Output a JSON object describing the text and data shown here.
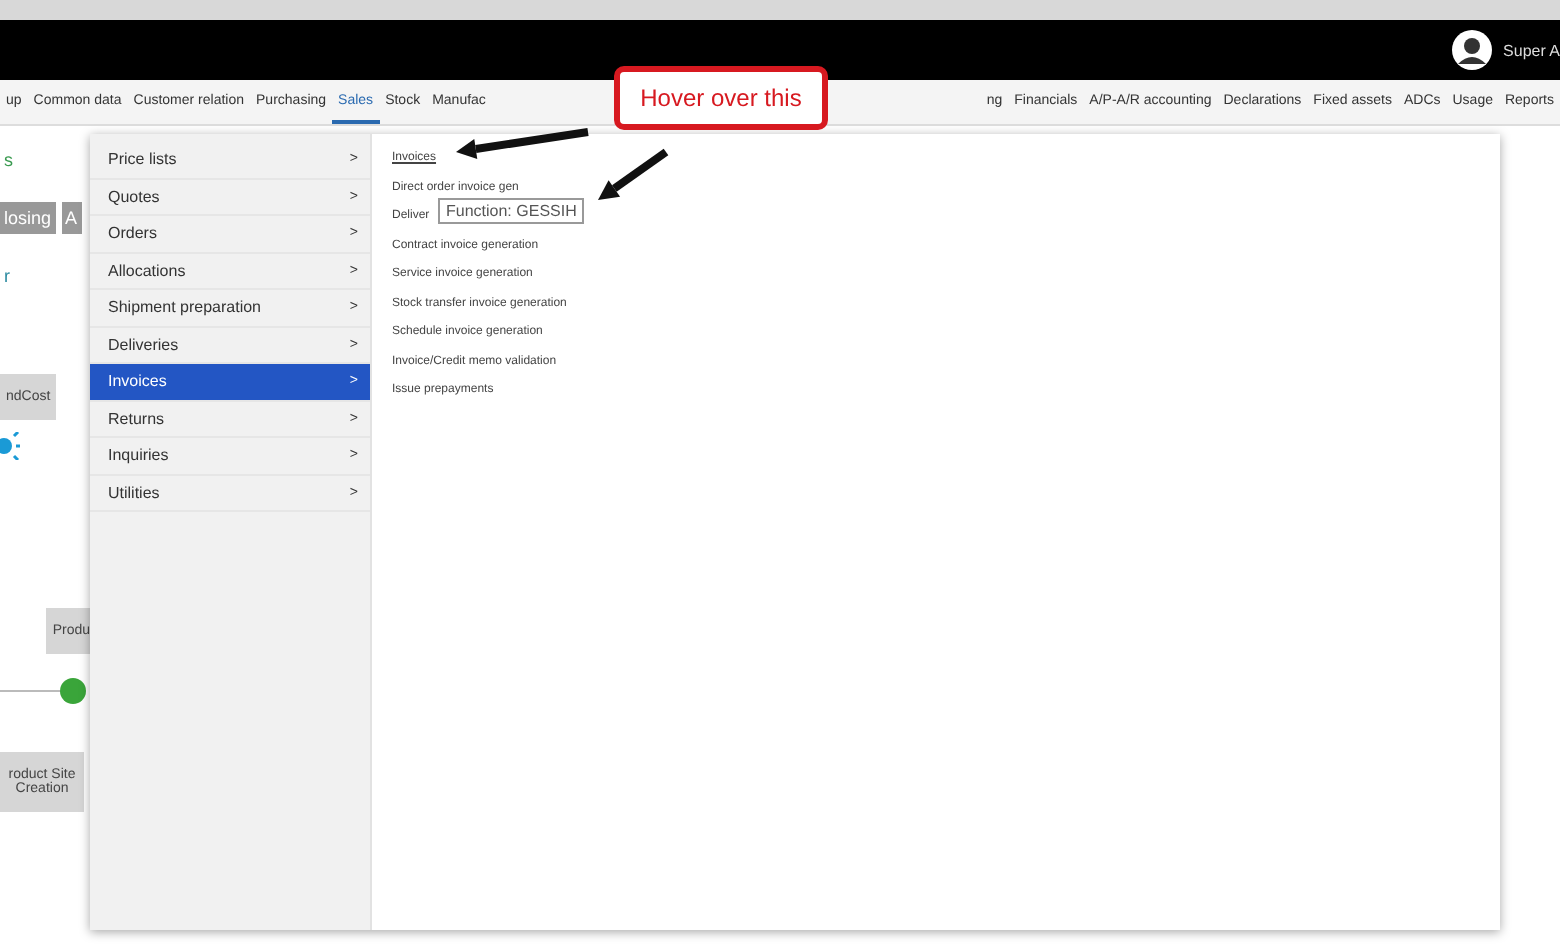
{
  "header": {
    "user": "Super A"
  },
  "nav": [
    {
      "label": "up",
      "selected": false
    },
    {
      "label": "Common data",
      "selected": false
    },
    {
      "label": "Customer relation",
      "selected": false
    },
    {
      "label": "Purchasing",
      "selected": false
    },
    {
      "label": "Sales",
      "selected": true
    },
    {
      "label": "Stock",
      "selected": false
    },
    {
      "label": "Manufac",
      "selected": false
    },
    {
      "label": "ng",
      "selected": false
    },
    {
      "label": "Financials",
      "selected": false
    },
    {
      "label": "A/P-A/R accounting",
      "selected": false
    },
    {
      "label": "Declarations",
      "selected": false
    },
    {
      "label": "Fixed assets",
      "selected": false
    },
    {
      "label": "ADCs",
      "selected": false
    },
    {
      "label": "Usage",
      "selected": false
    },
    {
      "label": "Reports",
      "selected": false
    }
  ],
  "background": {
    "title": "s",
    "button_1": "losing",
    "button_2": "A",
    "subtitle": "r",
    "node_1": "ndCost",
    "node_2": "Produ",
    "node_3": "roduct Site Creation"
  },
  "menu": [
    {
      "label": "Price lists",
      "selected": false
    },
    {
      "label": "Quotes",
      "selected": false
    },
    {
      "label": "Orders",
      "selected": false
    },
    {
      "label": "Allocations",
      "selected": false
    },
    {
      "label": "Shipment preparation",
      "selected": false
    },
    {
      "label": "Deliveries",
      "selected": false
    },
    {
      "label": "Invoices",
      "selected": true
    },
    {
      "label": "Returns",
      "selected": false
    },
    {
      "label": "Inquiries",
      "selected": false
    },
    {
      "label": "Utilities",
      "selected": false
    }
  ],
  "menu_arrow": ">",
  "submenu": [
    {
      "label": "Invoices",
      "hovered": true
    },
    {
      "label": "Direct order invoice gen",
      "hovered": false
    },
    {
      "label": "Deliver",
      "hovered": false
    },
    {
      "label": "Contract invoice generation",
      "hovered": false
    },
    {
      "label": "Service invoice generation",
      "hovered": false
    },
    {
      "label": "Stock transfer invoice generation",
      "hovered": false
    },
    {
      "label": "Schedule invoice generation",
      "hovered": false
    },
    {
      "label": "Invoice/Credit memo validation",
      "hovered": false
    },
    {
      "label": "Issue prepayments",
      "hovered": false
    }
  ],
  "tooltip": "Function: GESSIH",
  "callout": "Hover over this"
}
